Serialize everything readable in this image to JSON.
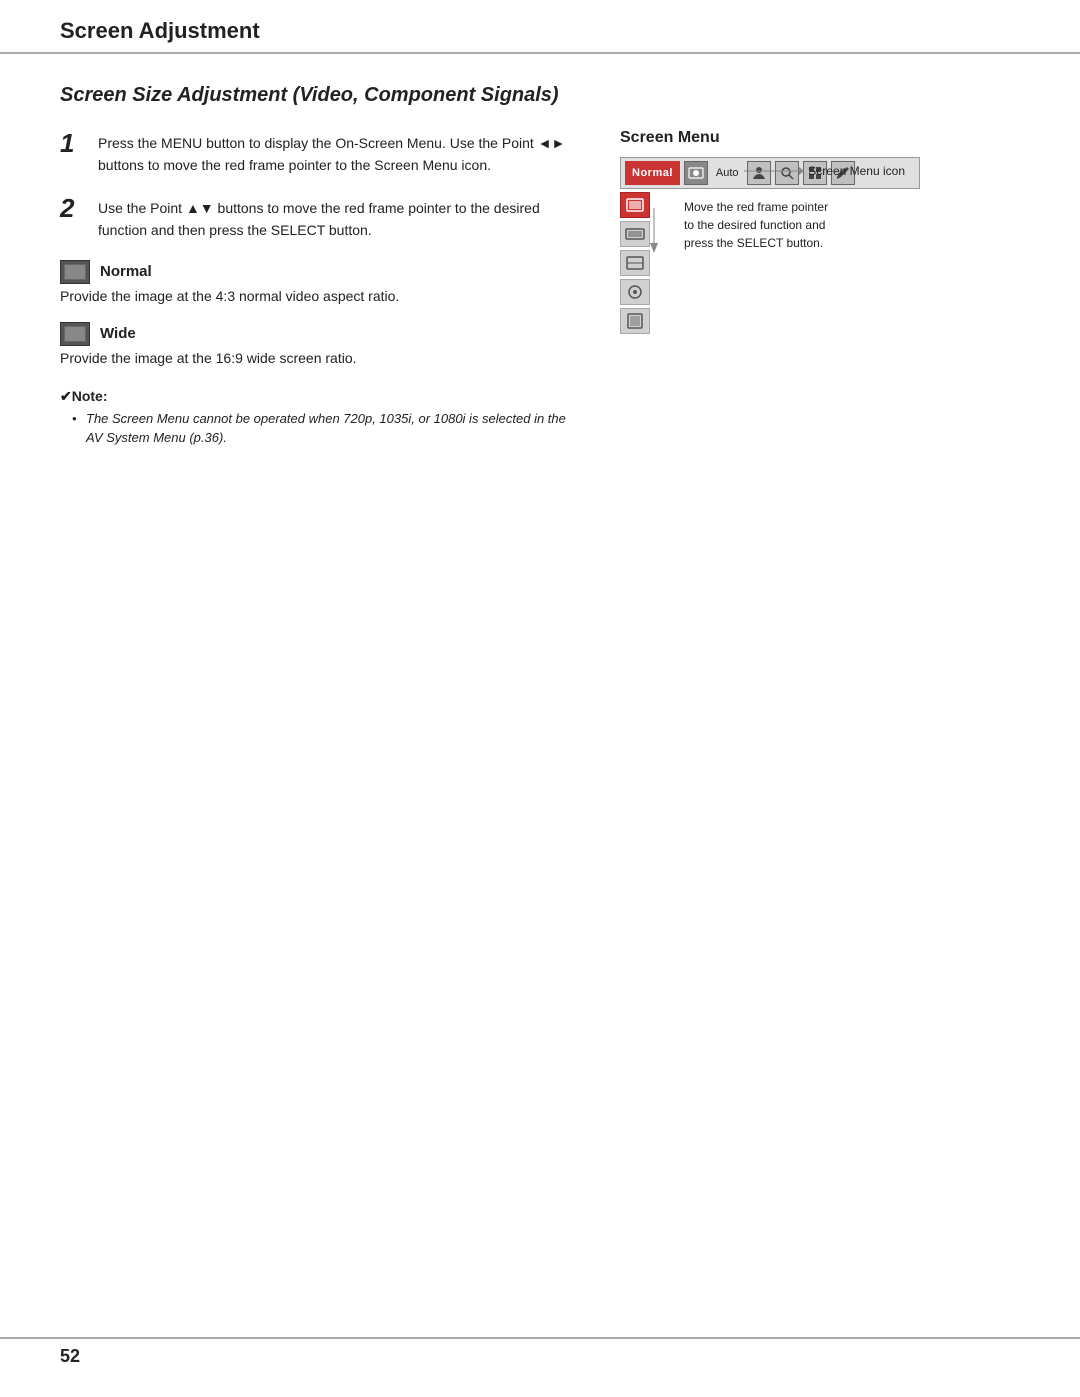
{
  "header": {
    "title": "Screen Adjustment"
  },
  "section": {
    "title": "Screen Size Adjustment (Video, Component Signals)"
  },
  "steps": [
    {
      "number": "1",
      "text": "Press the MENU button to display the On-Screen Menu. Use the Point ◄► buttons to move the red frame pointer to the Screen Menu icon."
    },
    {
      "number": "2",
      "text": "Use the Point ▲▼ buttons to move the red frame pointer to the desired function and then press the SELECT button."
    }
  ],
  "options": [
    {
      "label": "Normal",
      "description": "Provide the image at the 4:3 normal video aspect ratio."
    },
    {
      "label": "Wide",
      "description": "Provide the image at the 16:9 wide screen ratio."
    }
  ],
  "note": {
    "title": "✔Note:",
    "items": [
      "The Screen Menu cannot be operated when 720p, 1035i, or 1080i is selected in the AV System Menu (p.36)."
    ]
  },
  "screen_menu": {
    "title": "Screen Menu",
    "normal_label": "Normal",
    "auto_label": "Auto",
    "annotation_menu_icon": "Screen Menu icon",
    "annotation_pointer": "Move the red frame pointer\nto the desired function and\npress the SELECT button."
  },
  "page_number": "52"
}
